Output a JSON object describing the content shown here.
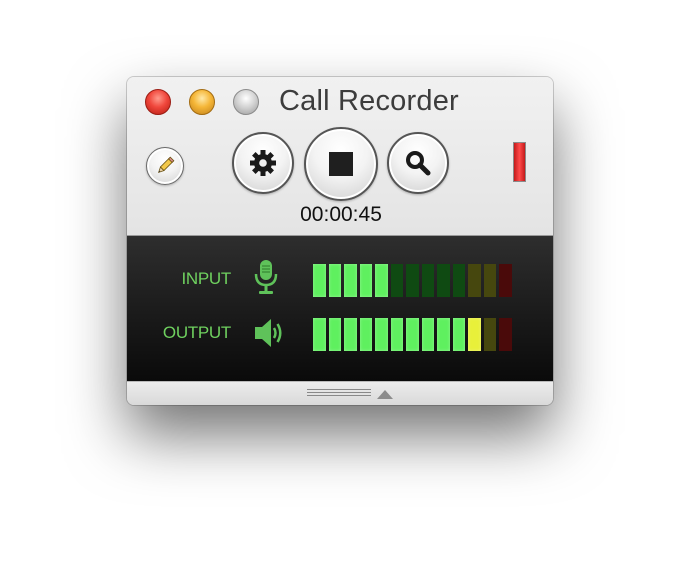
{
  "window": {
    "title": "Call Recorder"
  },
  "controls": {
    "timer": "00:00:45",
    "record_state": "recording",
    "indicator_color": "#ff3b3b"
  },
  "icons": {
    "notes": "pencil-icon",
    "settings": "gear-icon",
    "record": "stop-icon",
    "search": "magnifier-icon",
    "input": "microphone-icon",
    "output": "speaker-icon",
    "expand": "chevron-up-icon"
  },
  "meters": {
    "segment_count": 13,
    "input": {
      "label": "INPUT",
      "level_segments": 5,
      "peak_segment": null
    },
    "output": {
      "label": "OUTPUT",
      "level_segments": 11,
      "peak_segment": null
    },
    "colors": {
      "green_on": "#5ff05f",
      "green_off": "#0f4a12",
      "yellow_on": "#e8f03a",
      "yellow_off": "#46470e",
      "red_on": "#ff3030",
      "red_off": "#4a0a0a"
    },
    "zones": {
      "green_until": 10,
      "yellow_until": 12
    }
  }
}
